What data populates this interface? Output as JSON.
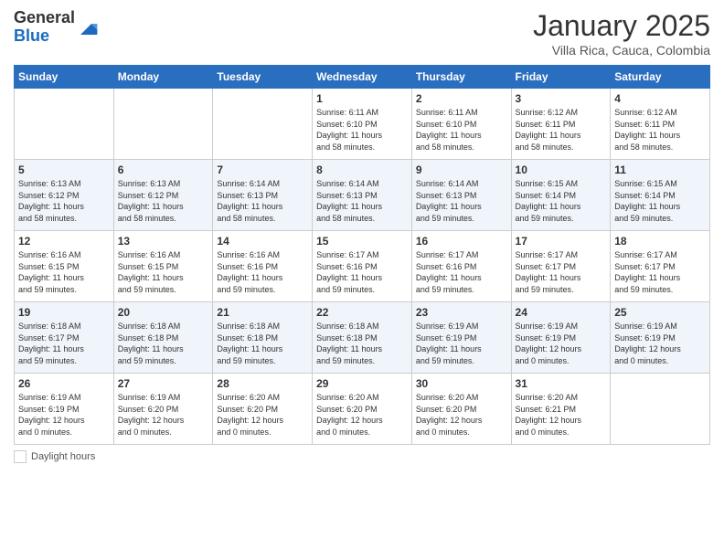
{
  "header": {
    "logo_general": "General",
    "logo_blue": "Blue",
    "month_title": "January 2025",
    "location": "Villa Rica, Cauca, Colombia"
  },
  "days_of_week": [
    "Sunday",
    "Monday",
    "Tuesday",
    "Wednesday",
    "Thursday",
    "Friday",
    "Saturday"
  ],
  "weeks": [
    [
      {
        "day": "",
        "info": ""
      },
      {
        "day": "",
        "info": ""
      },
      {
        "day": "",
        "info": ""
      },
      {
        "day": "1",
        "info": "Sunrise: 6:11 AM\nSunset: 6:10 PM\nDaylight: 11 hours\nand 58 minutes."
      },
      {
        "day": "2",
        "info": "Sunrise: 6:11 AM\nSunset: 6:10 PM\nDaylight: 11 hours\nand 58 minutes."
      },
      {
        "day": "3",
        "info": "Sunrise: 6:12 AM\nSunset: 6:11 PM\nDaylight: 11 hours\nand 58 minutes."
      },
      {
        "day": "4",
        "info": "Sunrise: 6:12 AM\nSunset: 6:11 PM\nDaylight: 11 hours\nand 58 minutes."
      }
    ],
    [
      {
        "day": "5",
        "info": "Sunrise: 6:13 AM\nSunset: 6:12 PM\nDaylight: 11 hours\nand 58 minutes."
      },
      {
        "day": "6",
        "info": "Sunrise: 6:13 AM\nSunset: 6:12 PM\nDaylight: 11 hours\nand 58 minutes."
      },
      {
        "day": "7",
        "info": "Sunrise: 6:14 AM\nSunset: 6:13 PM\nDaylight: 11 hours\nand 58 minutes."
      },
      {
        "day": "8",
        "info": "Sunrise: 6:14 AM\nSunset: 6:13 PM\nDaylight: 11 hours\nand 58 minutes."
      },
      {
        "day": "9",
        "info": "Sunrise: 6:14 AM\nSunset: 6:13 PM\nDaylight: 11 hours\nand 59 minutes."
      },
      {
        "day": "10",
        "info": "Sunrise: 6:15 AM\nSunset: 6:14 PM\nDaylight: 11 hours\nand 59 minutes."
      },
      {
        "day": "11",
        "info": "Sunrise: 6:15 AM\nSunset: 6:14 PM\nDaylight: 11 hours\nand 59 minutes."
      }
    ],
    [
      {
        "day": "12",
        "info": "Sunrise: 6:16 AM\nSunset: 6:15 PM\nDaylight: 11 hours\nand 59 minutes."
      },
      {
        "day": "13",
        "info": "Sunrise: 6:16 AM\nSunset: 6:15 PM\nDaylight: 11 hours\nand 59 minutes."
      },
      {
        "day": "14",
        "info": "Sunrise: 6:16 AM\nSunset: 6:16 PM\nDaylight: 11 hours\nand 59 minutes."
      },
      {
        "day": "15",
        "info": "Sunrise: 6:17 AM\nSunset: 6:16 PM\nDaylight: 11 hours\nand 59 minutes."
      },
      {
        "day": "16",
        "info": "Sunrise: 6:17 AM\nSunset: 6:16 PM\nDaylight: 11 hours\nand 59 minutes."
      },
      {
        "day": "17",
        "info": "Sunrise: 6:17 AM\nSunset: 6:17 PM\nDaylight: 11 hours\nand 59 minutes."
      },
      {
        "day": "18",
        "info": "Sunrise: 6:17 AM\nSunset: 6:17 PM\nDaylight: 11 hours\nand 59 minutes."
      }
    ],
    [
      {
        "day": "19",
        "info": "Sunrise: 6:18 AM\nSunset: 6:17 PM\nDaylight: 11 hours\nand 59 minutes."
      },
      {
        "day": "20",
        "info": "Sunrise: 6:18 AM\nSunset: 6:18 PM\nDaylight: 11 hours\nand 59 minutes."
      },
      {
        "day": "21",
        "info": "Sunrise: 6:18 AM\nSunset: 6:18 PM\nDaylight: 11 hours\nand 59 minutes."
      },
      {
        "day": "22",
        "info": "Sunrise: 6:18 AM\nSunset: 6:18 PM\nDaylight: 11 hours\nand 59 minutes."
      },
      {
        "day": "23",
        "info": "Sunrise: 6:19 AM\nSunset: 6:19 PM\nDaylight: 11 hours\nand 59 minutes."
      },
      {
        "day": "24",
        "info": "Sunrise: 6:19 AM\nSunset: 6:19 PM\nDaylight: 12 hours\nand 0 minutes."
      },
      {
        "day": "25",
        "info": "Sunrise: 6:19 AM\nSunset: 6:19 PM\nDaylight: 12 hours\nand 0 minutes."
      }
    ],
    [
      {
        "day": "26",
        "info": "Sunrise: 6:19 AM\nSunset: 6:19 PM\nDaylight: 12 hours\nand 0 minutes."
      },
      {
        "day": "27",
        "info": "Sunrise: 6:19 AM\nSunset: 6:20 PM\nDaylight: 12 hours\nand 0 minutes."
      },
      {
        "day": "28",
        "info": "Sunrise: 6:20 AM\nSunset: 6:20 PM\nDaylight: 12 hours\nand 0 minutes."
      },
      {
        "day": "29",
        "info": "Sunrise: 6:20 AM\nSunset: 6:20 PM\nDaylight: 12 hours\nand 0 minutes."
      },
      {
        "day": "30",
        "info": "Sunrise: 6:20 AM\nSunset: 6:20 PM\nDaylight: 12 hours\nand 0 minutes."
      },
      {
        "day": "31",
        "info": "Sunrise: 6:20 AM\nSunset: 6:21 PM\nDaylight: 12 hours\nand 0 minutes."
      },
      {
        "day": "",
        "info": ""
      }
    ]
  ],
  "footer": {
    "daylight_label": "Daylight hours"
  }
}
